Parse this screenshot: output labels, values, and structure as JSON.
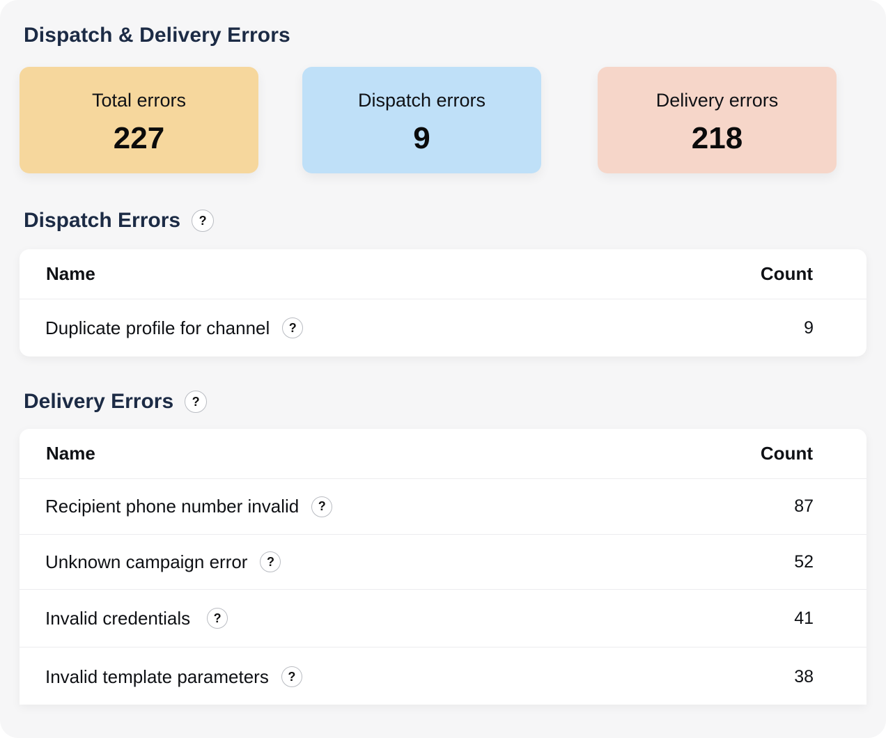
{
  "page": {
    "title": "Dispatch & Delivery Errors"
  },
  "summary": {
    "total": {
      "label": "Total errors",
      "value": "227",
      "color": "#f6d79d"
    },
    "dispatch": {
      "label": "Dispatch errors",
      "value": "9",
      "color": "#bfe0f8"
    },
    "delivery": {
      "label": "Delivery errors",
      "value": "218",
      "color": "#f6d6c9"
    }
  },
  "dispatch_section": {
    "title": "Dispatch Errors",
    "help_icon": "question-circle-icon",
    "columns": {
      "name": "Name",
      "count": "Count"
    },
    "rows": [
      {
        "name": "Duplicate profile for channel",
        "count": "9"
      }
    ]
  },
  "delivery_section": {
    "title": "Delivery Errors",
    "help_icon": "question-circle-icon",
    "columns": {
      "name": "Name",
      "count": "Count"
    },
    "rows": [
      {
        "name": "Recipient phone number invalid",
        "count": "87"
      },
      {
        "name": "Unknown campaign error",
        "count": "52"
      },
      {
        "name": "Invalid credentials",
        "count": "41"
      },
      {
        "name": "Invalid template parameters",
        "count": "38"
      }
    ]
  },
  "help_glyph": "?"
}
